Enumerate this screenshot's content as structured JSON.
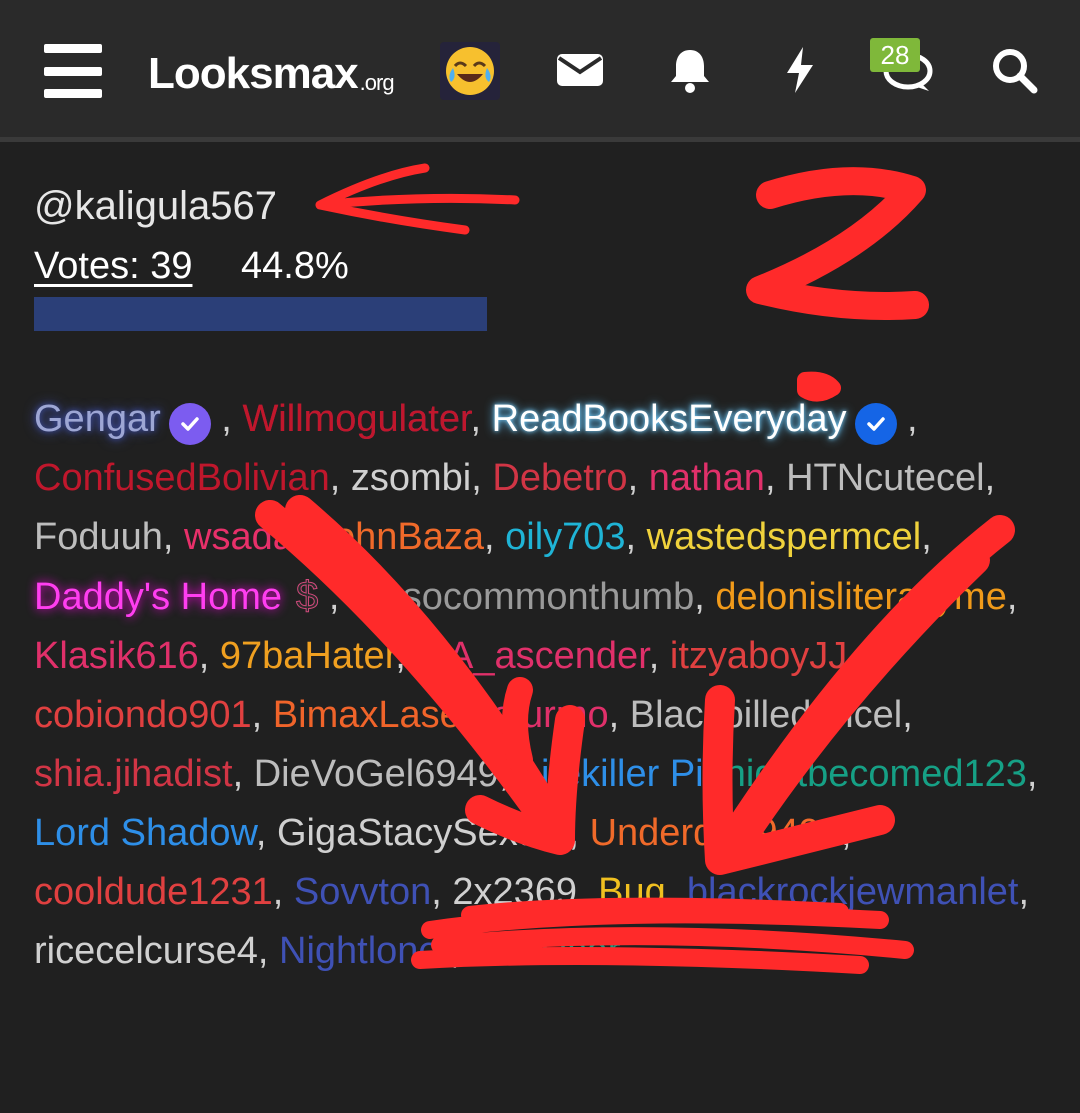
{
  "header": {
    "site_name": "Looksmax",
    "site_suffix": ".org",
    "emoji": "crying-laughing-emoji",
    "badge_count": "28",
    "icons": [
      "menu-icon",
      "mail-icon",
      "bell-icon",
      "lightning-icon",
      "chat-icon",
      "search-icon"
    ]
  },
  "poll": {
    "username": "@kaligula567",
    "votes_label": "Votes: 39",
    "percent_label": "44.8%",
    "percent_value": 44.8
  },
  "voters": [
    {
      "name": "Gengar",
      "color": "#9da6d4",
      "style": "glow-blue",
      "badge": "verified-purple"
    },
    {
      "name": "Willmogulater",
      "color": "#c0172c",
      "style": "grad"
    },
    {
      "name": "ReadBooksEveryday",
      "color": "#ffffff",
      "style": "glow-white",
      "badge": "verified-blue"
    },
    {
      "name": "ConfusedBolivian",
      "color": "#c0172c"
    },
    {
      "name": "zsombi",
      "color": "#d0d0d0"
    },
    {
      "name": "Debetro",
      "color": "#d13545"
    },
    {
      "name": "nathan",
      "color": "#e0306a"
    },
    {
      "name": "HTNcutecel",
      "color": "#bdbdbd"
    },
    {
      "name": "Foduuh",
      "color": "#bdbdbd"
    },
    {
      "name": "wsada",
      "color": "#e8306a"
    },
    {
      "name": "JohnBaza",
      "color": "#f06a2a"
    },
    {
      "name": "oily703",
      "color": "#1fb4d6"
    },
    {
      "name": "wastedspermcel",
      "color": "#f0d23c"
    },
    {
      "name": "Daddy's Home",
      "color": "#ff3ef0",
      "style": "glow-pink",
      "badge": "dollar"
    },
    {
      "name": "notsocommonthumb",
      "color": "#9a9a9a",
      "style": "strike"
    },
    {
      "name": "delonisliterallyme",
      "color": "#f09a1a"
    },
    {
      "name": "Klasik616",
      "color": "#e0306a"
    },
    {
      "name": "97baHater",
      "color": "#f0a020"
    },
    {
      "name": "MA_ascender",
      "color": "#e0306a"
    },
    {
      "name": "itzyaboyJJ",
      "color": "#e04040"
    },
    {
      "name": "cobiondo901",
      "color": "#e04040"
    },
    {
      "name": "BimaxLaser",
      "color": "#f0642a"
    },
    {
      "name": "alurmo",
      "color": "#e0306a"
    },
    {
      "name": "Blackpilled Incel",
      "color": "#bdbdbd"
    },
    {
      "name": "shia.jihadist",
      "color": "#d13545"
    },
    {
      "name": "DieVoGel6949",
      "color": "#bdbdbd"
    },
    {
      "name": "Litekiller Pi",
      "color": "#2e8fe8"
    },
    {
      "name": "nightbecomed123",
      "color": "#16a085"
    },
    {
      "name": "Lord Shadow",
      "color": "#2e8fe8"
    },
    {
      "name": "GigaStacySexual",
      "color": "#d0d0d0"
    },
    {
      "name": "Underdog9494",
      "color": "#f06a2a"
    },
    {
      "name": "cooldude1231",
      "color": "#e04040"
    },
    {
      "name": "Sovvton",
      "color": "#3f51b5"
    },
    {
      "name": "2x2369",
      "color": "#d0d0d0"
    },
    {
      "name": "Bug",
      "color": "#f0c020"
    },
    {
      "name": "blackrockjewmanlet",
      "color": "#3f51b5"
    },
    {
      "name": "ricecelcurse4",
      "color": "#d0d0d0"
    },
    {
      "name": "Nightloner",
      "color": "#3f51b5"
    },
    {
      "name": "LTNUser",
      "color": "#16a085"
    }
  ],
  "overlay": {
    "handwritten_text": "2"
  }
}
